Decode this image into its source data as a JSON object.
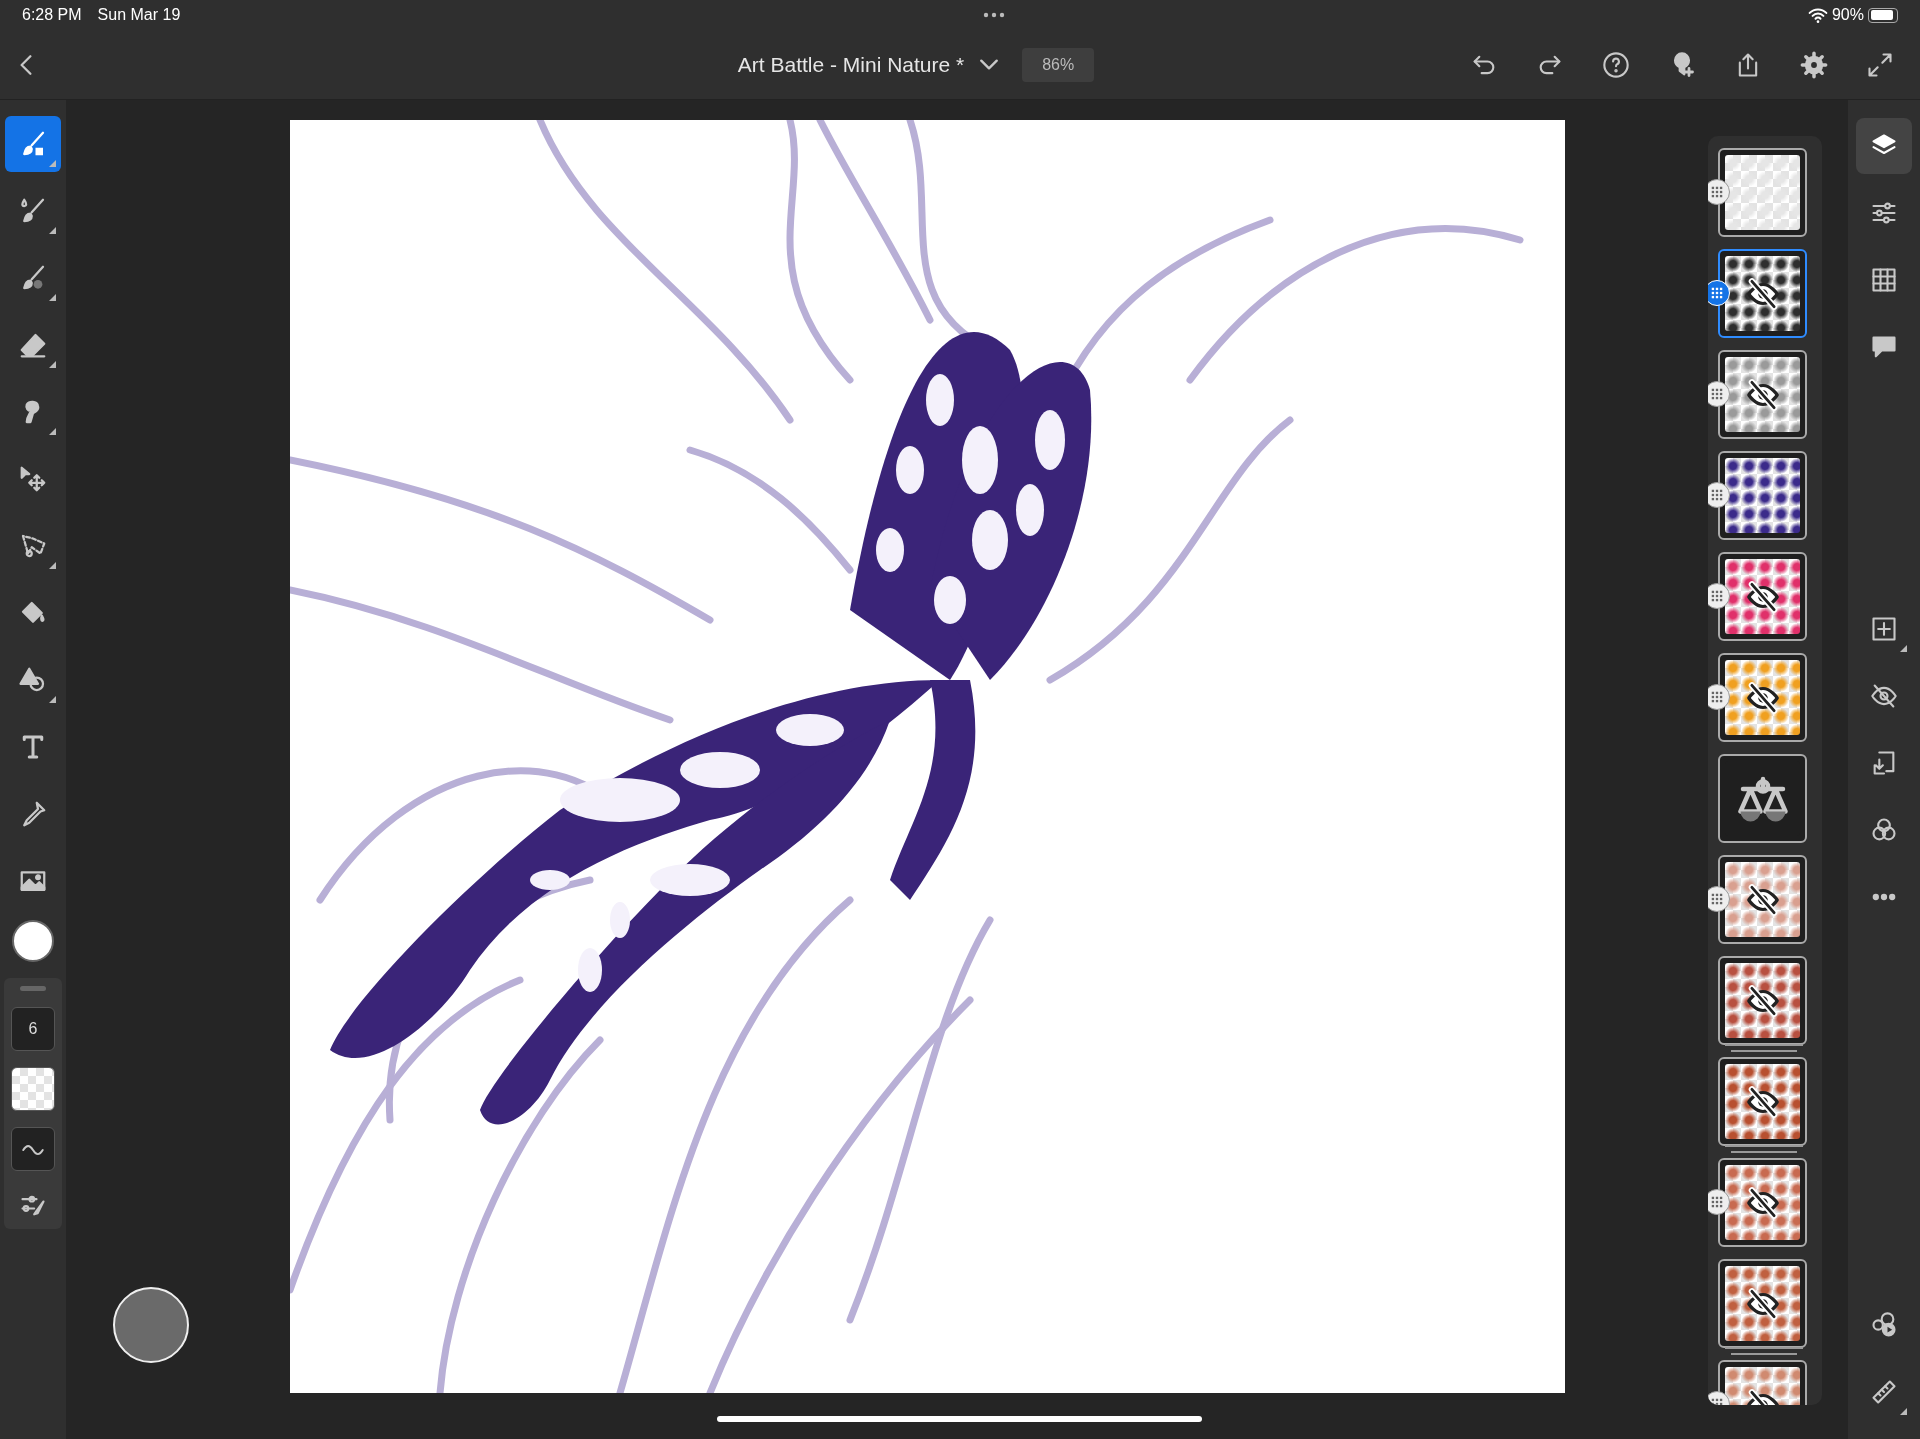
{
  "status_bar": {
    "time": "6:28 PM",
    "date": "Sun Mar 19",
    "battery_text": "90%",
    "battery": {
      "level": 0.9
    }
  },
  "top_bar": {
    "title": "Art Battle - Mini Nature *",
    "zoom": "86%"
  },
  "tools": [
    {
      "kind": "pixel-brush",
      "selected": true
    },
    {
      "kind": "live-brush",
      "selected": false
    },
    {
      "kind": "vector-brush",
      "selected": false
    },
    {
      "kind": "eraser",
      "selected": false
    },
    {
      "kind": "smudge",
      "selected": false
    },
    {
      "kind": "move",
      "selected": false
    },
    {
      "kind": "lasso",
      "selected": false
    },
    {
      "kind": "fill",
      "selected": false
    },
    {
      "kind": "shape",
      "selected": false
    },
    {
      "kind": "text",
      "selected": false
    },
    {
      "kind": "eyedropper",
      "selected": false
    },
    {
      "kind": "image",
      "selected": false
    }
  ],
  "brush_settings": {
    "size": "6"
  },
  "layers": [
    {
      "kind": "pixel",
      "color": "#e6e6e6",
      "selected": false,
      "hidden": false,
      "handle": true,
      "stacked": false
    },
    {
      "kind": "pixel",
      "color": "#2e2e2e",
      "selected": true,
      "hidden": true,
      "handle": true,
      "stacked": false
    },
    {
      "kind": "pixel",
      "color": "#9a9a9a",
      "selected": false,
      "hidden": true,
      "handle": true,
      "stacked": false
    },
    {
      "kind": "pixel",
      "color": "#3b2a8a",
      "selected": false,
      "hidden": false,
      "handle": true,
      "stacked": false
    },
    {
      "kind": "pixel",
      "color": "#e0306a",
      "selected": false,
      "hidden": true,
      "handle": true,
      "stacked": false
    },
    {
      "kind": "pixel",
      "color": "#f0a020",
      "selected": false,
      "hidden": true,
      "handle": true,
      "stacked": false
    },
    {
      "kind": "adjustment",
      "selected": false
    },
    {
      "kind": "pixel",
      "color": "#d9a090",
      "selected": false,
      "hidden": true,
      "handle": true,
      "stacked": false
    },
    {
      "kind": "pixel",
      "color": "#b85040",
      "selected": false,
      "hidden": true,
      "handle": false,
      "stacked": true
    },
    {
      "kind": "pixel",
      "color": "#b85030",
      "selected": false,
      "hidden": true,
      "handle": false,
      "stacked": true
    },
    {
      "kind": "pixel",
      "color": "#c86a50",
      "selected": false,
      "hidden": true,
      "handle": true,
      "stacked": false
    },
    {
      "kind": "pixel",
      "color": "#c06040",
      "selected": false,
      "hidden": true,
      "handle": false,
      "stacked": true
    },
    {
      "kind": "pixel",
      "color": "#d08a70",
      "selected": false,
      "hidden": true,
      "handle": true,
      "stacked": false
    }
  ],
  "right_tools_top": [
    {
      "kind": "layers",
      "selected": true
    },
    {
      "kind": "properties",
      "selected": false
    },
    {
      "kind": "grid",
      "selected": false
    },
    {
      "kind": "comment",
      "selected": false
    }
  ],
  "right_tools_middle": [
    {
      "kind": "add-layer",
      "selected": false
    },
    {
      "kind": "hide",
      "selected": false
    },
    {
      "kind": "merge",
      "selected": false
    },
    {
      "kind": "blend",
      "selected": false
    },
    {
      "kind": "more",
      "selected": false
    }
  ],
  "right_tools_bottom": [
    {
      "kind": "libraries",
      "selected": false
    },
    {
      "kind": "ruler",
      "selected": false
    }
  ]
}
